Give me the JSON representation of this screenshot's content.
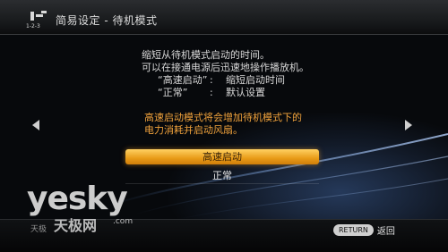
{
  "header": {
    "logo_text": "1-2-3",
    "breadcrumb": "简易设定 - 待机模式"
  },
  "description": {
    "line1": "缩短从待机模式启动的时间。",
    "line2": "可以在接通电源后迅速地操作播放机。",
    "options": [
      {
        "name": "“高速启动”",
        "colon": ":",
        "desc": "缩短启动时间"
      },
      {
        "name": "“正常”",
        "colon": ":",
        "desc": "默认设置"
      }
    ]
  },
  "warning": {
    "line1": "高速启动模式将会增加待机模式下的",
    "line2": "电力消耗并启动风扇。"
  },
  "menu": {
    "items": [
      {
        "label": "高速启动",
        "selected": true
      },
      {
        "label": "正常",
        "selected": false
      }
    ]
  },
  "footer": {
    "back_key": "RETURN",
    "back_label": "返回"
  },
  "watermark": {
    "brand": "yesky",
    "cn": "天极网",
    "com": ".com",
    "small": "天极"
  },
  "colors": {
    "accent": "#e89b17",
    "warning": "#f0a23c"
  }
}
